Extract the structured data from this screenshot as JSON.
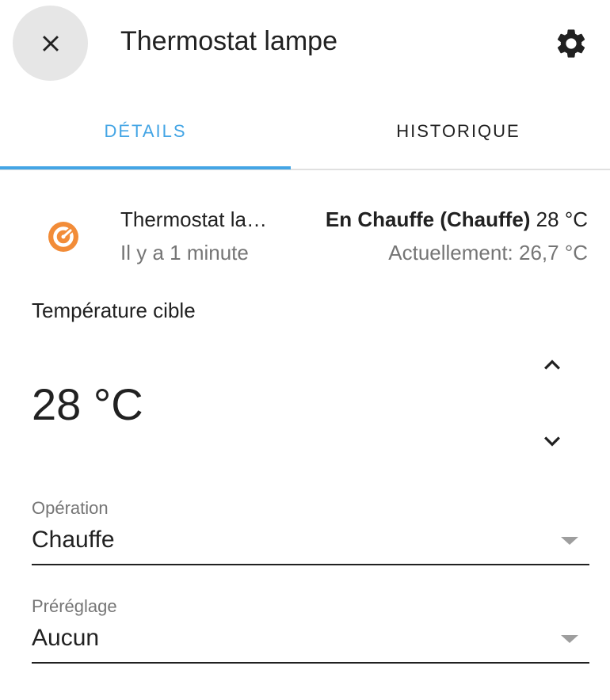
{
  "header": {
    "title": "Thermostat lampe",
    "close_icon": "close-icon",
    "settings_icon": "gear-icon"
  },
  "tabs": [
    {
      "label": "Détails",
      "active": true
    },
    {
      "label": "Historique",
      "active": false
    }
  ],
  "colors": {
    "accent": "#44a5e5",
    "state_icon": "#f28c38",
    "secondary_text": "#757575"
  },
  "state": {
    "icon": "thermostat-icon",
    "entity_name": "Thermostat lampe",
    "last_changed": "Il y a 1 minute",
    "mode": "En Chauffe (Chauffe)",
    "target": "28 °C",
    "current": "Actuellement: 26,7 °C"
  },
  "target_temperature": {
    "label": "Température cible",
    "value": "28 °C",
    "up_icon": "chevron-up-icon",
    "down_icon": "chevron-down-icon"
  },
  "operation": {
    "label": "Opération",
    "value": "Chauffe"
  },
  "preset": {
    "label": "Préréglage",
    "value": "Aucun"
  }
}
